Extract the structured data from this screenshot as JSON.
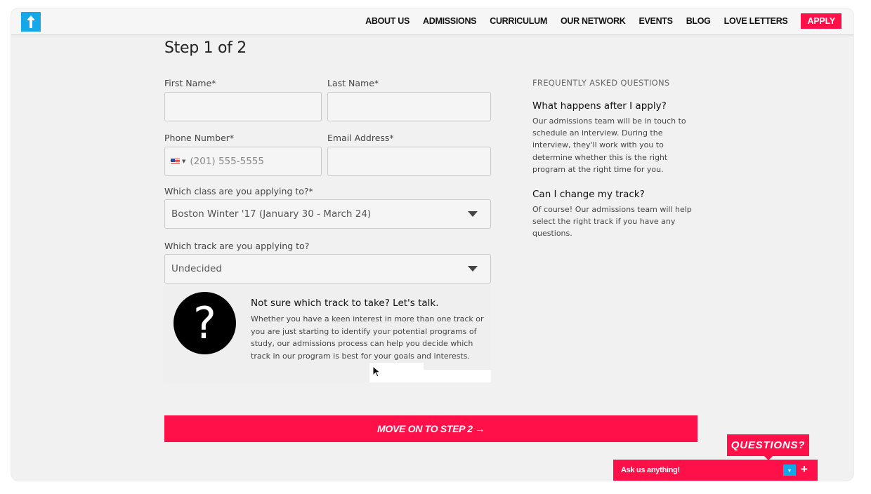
{
  "nav": {
    "logo_icon": "up-arrow-icon",
    "links": [
      "ABOUT US",
      "ADMISSIONS",
      "CURRICULUM",
      "OUR NETWORK",
      "EVENTS",
      "BLOG",
      "LOVE LETTERS"
    ],
    "apply_label": "APPLY"
  },
  "form": {
    "step_title": "Step 1 of 2",
    "first_name": {
      "label": "First Name*",
      "value": ""
    },
    "last_name": {
      "label": "Last Name*",
      "value": ""
    },
    "phone": {
      "label": "Phone Number*",
      "placeholder": "(201) 555-5555"
    },
    "email": {
      "label": "Email Address*",
      "value": ""
    },
    "class_select": {
      "label": "Which class are you applying to?*",
      "selected": "Boston Winter '17 (January 30 - March 24)"
    },
    "track_select": {
      "label": "Which track are you applying to?",
      "selected": "Undecided"
    }
  },
  "help": {
    "icon": "question-mark-icon",
    "icon_glyph": "?",
    "title": "Not sure which track to take? Let's talk.",
    "text": "Whether you have a keen interest in more than one track or you are just starting to identify your potential programs of study, our admissions process can help you decide which track in our program is best for your goals and interests."
  },
  "faq": {
    "heading": "FREQUENTLY ASKED QUESTIONS",
    "items": [
      {
        "q": "What happens after I apply?",
        "a": "Our admissions team will be in touch to schedule an interview. During the interview, they'll work with you to determine whether this is the right program at the right time for you."
      },
      {
        "q": "Can I change my track?",
        "a": "Of course! Our admissions team will help select the right track if you have any questions."
      }
    ]
  },
  "cta": {
    "label": "MOVE ON TO STEP 2 →"
  },
  "chat": {
    "tag": "QUESTIONS?",
    "label": "Ask us anything!",
    "min_glyph": "▾",
    "plus_glyph": "+"
  },
  "colors": {
    "accent": "#ff1048",
    "logo": "#14a8e8"
  }
}
